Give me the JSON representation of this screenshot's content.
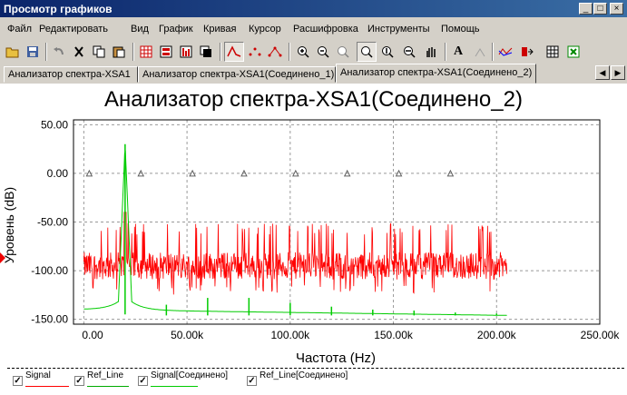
{
  "window": {
    "title": "Просмотр графиков",
    "buttons": {
      "minimize": "_",
      "maximize": "□",
      "close": "×"
    }
  },
  "menu": [
    "Файл",
    "Редактировать",
    "Вид",
    "График",
    "Кривая",
    "Курсор",
    "Расшифровка",
    "Инструменты",
    "Помощь"
  ],
  "toolbar": {
    "icons": [
      "open-icon",
      "save-icon",
      "undo-icon",
      "cut-icon",
      "copy-icon",
      "paste-icon",
      "grid-icon",
      "legend-icon",
      "select-mark-icon",
      "overlay-icon",
      "lines-icon",
      "dots-icon",
      "line-dots-icon",
      "zoom-in-icon",
      "zoom-out-icon",
      "zoom-fit-icon",
      "zoom-x-icon",
      "zoom-y-icon",
      "zoom-region-icon",
      "pan-icon",
      "text-icon",
      "properties-icon",
      "export-icon",
      "transfer-icon",
      "table-icon",
      "excel-icon"
    ]
  },
  "tabs": [
    {
      "label": "Анализатор спектра-XSA1",
      "active": false
    },
    {
      "label": "Анализатор спектра-XSA1(Соединено_1)",
      "active": false
    },
    {
      "label": "Анализатор спектра-XSA1(Соединено_2)",
      "active": true
    }
  ],
  "tab_arrows": {
    "left": "◀",
    "right": "▶"
  },
  "chart_data": {
    "type": "line",
    "title": "Анализатор спектра-XSA1(Соединено_2)",
    "xlabel": "Частота (Hz)",
    "ylabel": "Уровень (dB)",
    "xlim": [
      -5000,
      250000
    ],
    "ylim": [
      -155,
      55
    ],
    "x_ticks": [
      0,
      50000,
      100000,
      150000,
      200000,
      250000
    ],
    "x_tick_labels": [
      "0.00",
      "50.00k",
      "100.00k",
      "150.00k",
      "200.00k",
      "250.00k"
    ],
    "y_ticks": [
      50,
      0,
      -50,
      -100,
      -150
    ],
    "y_tick_labels": [
      "50.00",
      "0.00",
      "-50.00",
      "-100.00",
      "-150.00"
    ],
    "grid": true,
    "colors": {
      "signal": "#ff0000",
      "signal_connected": "#00cc00",
      "ref": "#00aa00",
      "triangle": "#606060"
    },
    "series": [
      {
        "name": "Signal",
        "kind": "noise",
        "x_range": [
          0,
          205000
        ],
        "level_mean": -95,
        "level_low": -115,
        "level_high": -55,
        "peaks": [
          {
            "x": 20000,
            "y": -40
          }
        ]
      },
      {
        "name": "Signal[Соединено]",
        "kind": "spectrum",
        "x_range": [
          0,
          205000
        ],
        "fundamental": {
          "x": 20000,
          "y": 30
        },
        "harmonics": [
          {
            "x": 40000,
            "y": -135
          },
          {
            "x": 60000,
            "y": -128
          },
          {
            "x": 80000,
            "y": -128
          },
          {
            "x": 100000,
            "y": -133
          },
          {
            "x": 120000,
            "y": -137
          },
          {
            "x": 140000,
            "y": -140
          },
          {
            "x": 160000,
            "y": -141
          },
          {
            "x": 180000,
            "y": -143
          },
          {
            "x": 200000,
            "y": -144
          }
        ]
      },
      {
        "name": "Ref_Line",
        "kind": "markers",
        "y": 0,
        "x": [
          0,
          25000,
          50000,
          75000,
          100000,
          125000,
          150000,
          175000
        ]
      }
    ]
  },
  "legend": [
    {
      "label": "Signal",
      "color": "#ff0000",
      "checked": true
    },
    {
      "label": "Ref_Line",
      "color": "#00aa00",
      "checked": true
    },
    {
      "label": "Signal[Соединено]",
      "color": "#00cc00",
      "checked": true
    },
    {
      "label": "Ref_Line[Соединено]",
      "color": "#00aa00",
      "checked": true
    }
  ]
}
